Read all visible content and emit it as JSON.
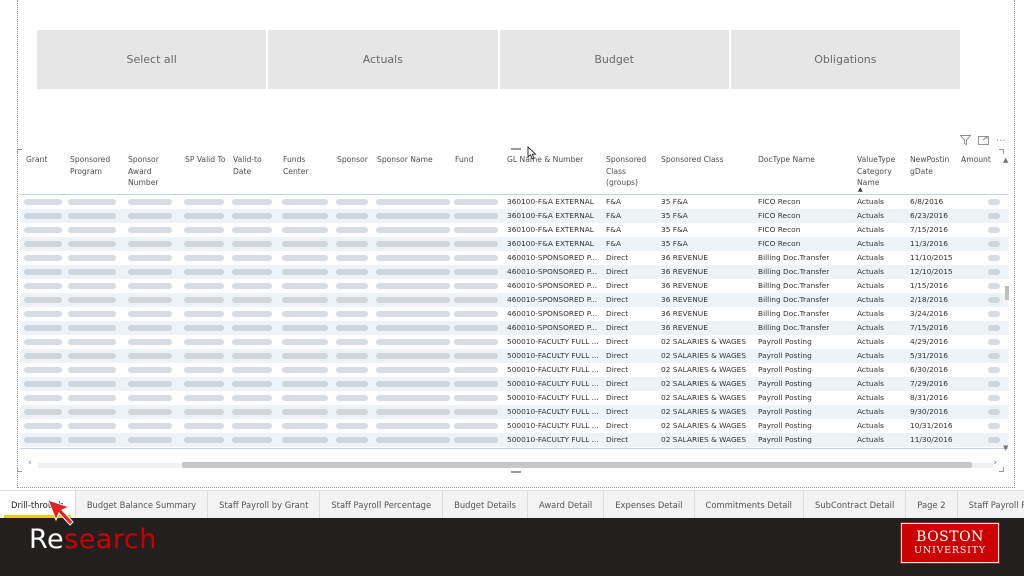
{
  "slicer": {
    "buttons": [
      "Select all",
      "Actuals",
      "Budget",
      "Obligations"
    ]
  },
  "visual_header": {
    "filter_icon": "filter-icon",
    "focus_icon": "focus-mode-icon",
    "more_icon": "more-options-icon",
    "more_label": "···"
  },
  "table": {
    "headers": {
      "grant": "Grant",
      "sponsored_program": "Sponsored Program",
      "sponsor_award_number": "Sponsor Award Number",
      "sp_valid_to": "SP Valid To",
      "valid_to_date": "Valid-to Date",
      "funds_center": "Funds Center",
      "sponsor": "Sponsor",
      "sponsor_name": "Sponsor Name",
      "fund": "Fund",
      "gl_name_number": "GL Name & Number",
      "sponsored_class_groups": "Sponsored Class (groups)",
      "sponsored_class": "Sponsored Class",
      "doctype_name": "DocType Name",
      "valuetype_category_name": "ValueType Category Name",
      "newposting_date": "NewPostin gDate",
      "amount": "Amount"
    },
    "rows": [
      {
        "gl": "360100-F&A EXTERNAL",
        "class_group": "F&A",
        "class": "35 F&A",
        "doctype": "FICO Recon",
        "valuetype": "Actuals",
        "date": "6/8/2016"
      },
      {
        "gl": "360100-F&A EXTERNAL",
        "class_group": "F&A",
        "class": "35 F&A",
        "doctype": "FICO Recon",
        "valuetype": "Actuals",
        "date": "6/23/2016"
      },
      {
        "gl": "360100-F&A EXTERNAL",
        "class_group": "F&A",
        "class": "35 F&A",
        "doctype": "FICO Recon",
        "valuetype": "Actuals",
        "date": "7/15/2016"
      },
      {
        "gl": "360100-F&A EXTERNAL",
        "class_group": "F&A",
        "class": "35 F&A",
        "doctype": "FICO Recon",
        "valuetype": "Actuals",
        "date": "11/3/2016"
      },
      {
        "gl": "460010-SPONSORED P...",
        "class_group": "Direct",
        "class": "36 REVENUE",
        "doctype": "Billing Doc.Transfer",
        "valuetype": "Actuals",
        "date": "11/10/2015"
      },
      {
        "gl": "460010-SPONSORED P...",
        "class_group": "Direct",
        "class": "36 REVENUE",
        "doctype": "Billing Doc.Transfer",
        "valuetype": "Actuals",
        "date": "12/10/2015"
      },
      {
        "gl": "460010-SPONSORED P...",
        "class_group": "Direct",
        "class": "36 REVENUE",
        "doctype": "Billing Doc.Transfer",
        "valuetype": "Actuals",
        "date": "1/15/2016"
      },
      {
        "gl": "460010-SPONSORED P...",
        "class_group": "Direct",
        "class": "36 REVENUE",
        "doctype": "Billing Doc.Transfer",
        "valuetype": "Actuals",
        "date": "2/18/2016"
      },
      {
        "gl": "460010-SPONSORED P...",
        "class_group": "Direct",
        "class": "36 REVENUE",
        "doctype": "Billing Doc.Transfer",
        "valuetype": "Actuals",
        "date": "3/24/2016"
      },
      {
        "gl": "460010-SPONSORED P...",
        "class_group": "Direct",
        "class": "36 REVENUE",
        "doctype": "Billing Doc.Transfer",
        "valuetype": "Actuals",
        "date": "7/15/2016"
      },
      {
        "gl": "500010-FACULTY FULL ...",
        "class_group": "Direct",
        "class": "02 SALARIES & WAGES",
        "doctype": "Payroll Posting",
        "valuetype": "Actuals",
        "date": "4/29/2016"
      },
      {
        "gl": "500010-FACULTY FULL ...",
        "class_group": "Direct",
        "class": "02 SALARIES & WAGES",
        "doctype": "Payroll Posting",
        "valuetype": "Actuals",
        "date": "5/31/2016"
      },
      {
        "gl": "500010-FACULTY FULL ...",
        "class_group": "Direct",
        "class": "02 SALARIES & WAGES",
        "doctype": "Payroll Posting",
        "valuetype": "Actuals",
        "date": "6/30/2016"
      },
      {
        "gl": "500010-FACULTY FULL ...",
        "class_group": "Direct",
        "class": "02 SALARIES & WAGES",
        "doctype": "Payroll Posting",
        "valuetype": "Actuals",
        "date": "7/29/2016"
      },
      {
        "gl": "500010-FACULTY FULL ...",
        "class_group": "Direct",
        "class": "02 SALARIES & WAGES",
        "doctype": "Payroll Posting",
        "valuetype": "Actuals",
        "date": "8/31/2016"
      },
      {
        "gl": "500010-FACULTY FULL ...",
        "class_group": "Direct",
        "class": "02 SALARIES & WAGES",
        "doctype": "Payroll Posting",
        "valuetype": "Actuals",
        "date": "9/30/2016"
      },
      {
        "gl": "500010-FACULTY FULL ...",
        "class_group": "Direct",
        "class": "02 SALARIES & WAGES",
        "doctype": "Payroll Posting",
        "valuetype": "Actuals",
        "date": "10/31/2016"
      },
      {
        "gl": "500010-FACULTY FULL ...",
        "class_group": "Direct",
        "class": "02 SALARIES & WAGES",
        "doctype": "Payroll Posting",
        "valuetype": "Actuals",
        "date": "11/30/2016"
      }
    ]
  },
  "tabs": {
    "items": [
      "Drill-through",
      "Budget Balance Summary",
      "Staff Payroll by Grant",
      "Staff Payroll Percentage",
      "Budget Details",
      "Award Detail",
      "Expenses Detail",
      "Commitments Detail",
      "SubContract Detail",
      "Page 2",
      "Staff Payroll Percentage"
    ],
    "active": "Drill-through"
  },
  "footer": {
    "brand_prefix": "Re",
    "brand_highlight": "search",
    "logo_line1": "BOSTON",
    "logo_line2": "UNIVERSITY"
  },
  "colors": {
    "active_tab_accent": "#f2c811",
    "bu_red": "#cc0000",
    "footer_bg": "#221f1e"
  }
}
